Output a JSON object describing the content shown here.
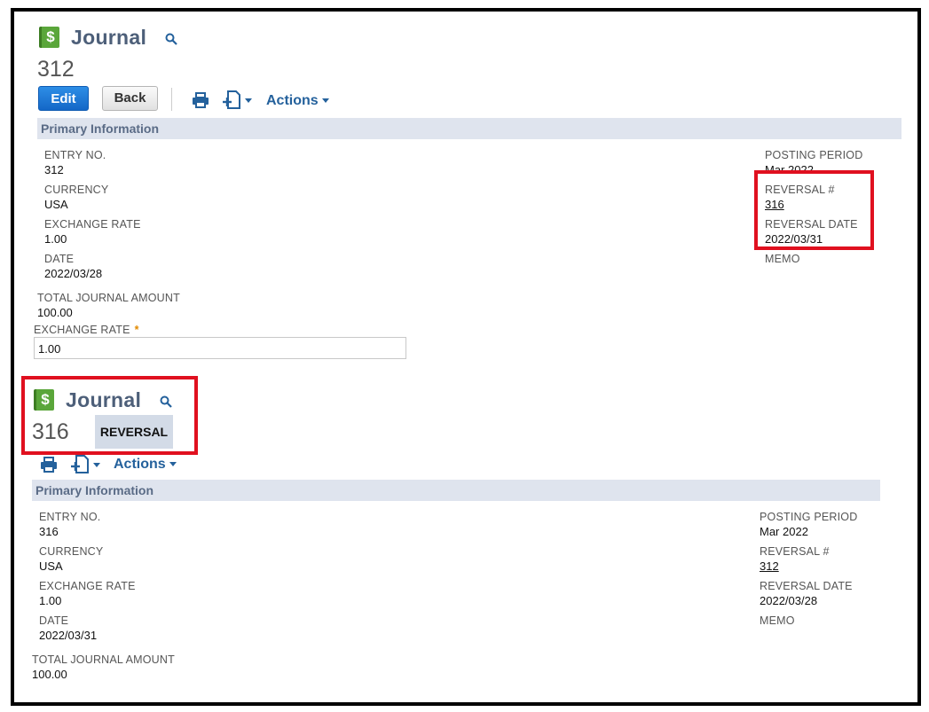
{
  "record1": {
    "title": "Journal",
    "number": "312",
    "buttons": {
      "edit": "Edit",
      "back": "Back"
    },
    "actions_label": "Actions",
    "section": "Primary Information",
    "fields": {
      "entry_no_label": "ENTRY NO.",
      "entry_no": "312",
      "currency_label": "CURRENCY",
      "currency": "USA",
      "exchange_rate_label": "EXCHANGE RATE",
      "exchange_rate": "1.00",
      "date_label": "DATE",
      "date": "2022/03/28",
      "posting_period_label": "POSTING PERIOD",
      "posting_period": "Mar 2022",
      "reversal_no_label": "REVERSAL #",
      "reversal_no": "316",
      "reversal_date_label": "REVERSAL DATE",
      "reversal_date": "2022/03/31",
      "memo_label": "MEMO",
      "total_label": "TOTAL JOURNAL AMOUNT",
      "total": "100.00",
      "exchange_rate_input_label": "EXCHANGE RATE",
      "exchange_rate_input_value": "1.00",
      "required_mark": "*"
    }
  },
  "record2": {
    "title": "Journal",
    "number": "316",
    "status_badge": "REVERSAL",
    "actions_label": "Actions",
    "section": "Primary Information",
    "fields": {
      "entry_no_label": "ENTRY NO.",
      "entry_no": "316",
      "currency_label": "CURRENCY",
      "currency": "USA",
      "exchange_rate_label": "EXCHANGE RATE",
      "exchange_rate": "1.00",
      "date_label": "DATE",
      "date": "2022/03/31",
      "posting_period_label": "POSTING PERIOD",
      "posting_period": "Mar 2022",
      "reversal_no_label": "REVERSAL #",
      "reversal_no": "312",
      "reversal_date_label": "REVERSAL DATE",
      "reversal_date": "2022/03/28",
      "memo_label": "MEMO",
      "total_label": "TOTAL JOURNAL AMOUNT",
      "total": "100.00"
    }
  },
  "icons": {
    "record": "dollar-ledger-icon",
    "search": "search-icon",
    "print": "printer-icon",
    "new": "new-document-icon",
    "dropdown": "chevron-down-icon"
  },
  "colors": {
    "title": "#4d5f79",
    "edit_button": "#1467c7",
    "section_bg": "#dfe4ee",
    "highlight": "#e0101f",
    "record_icon": "#5aa63a"
  }
}
